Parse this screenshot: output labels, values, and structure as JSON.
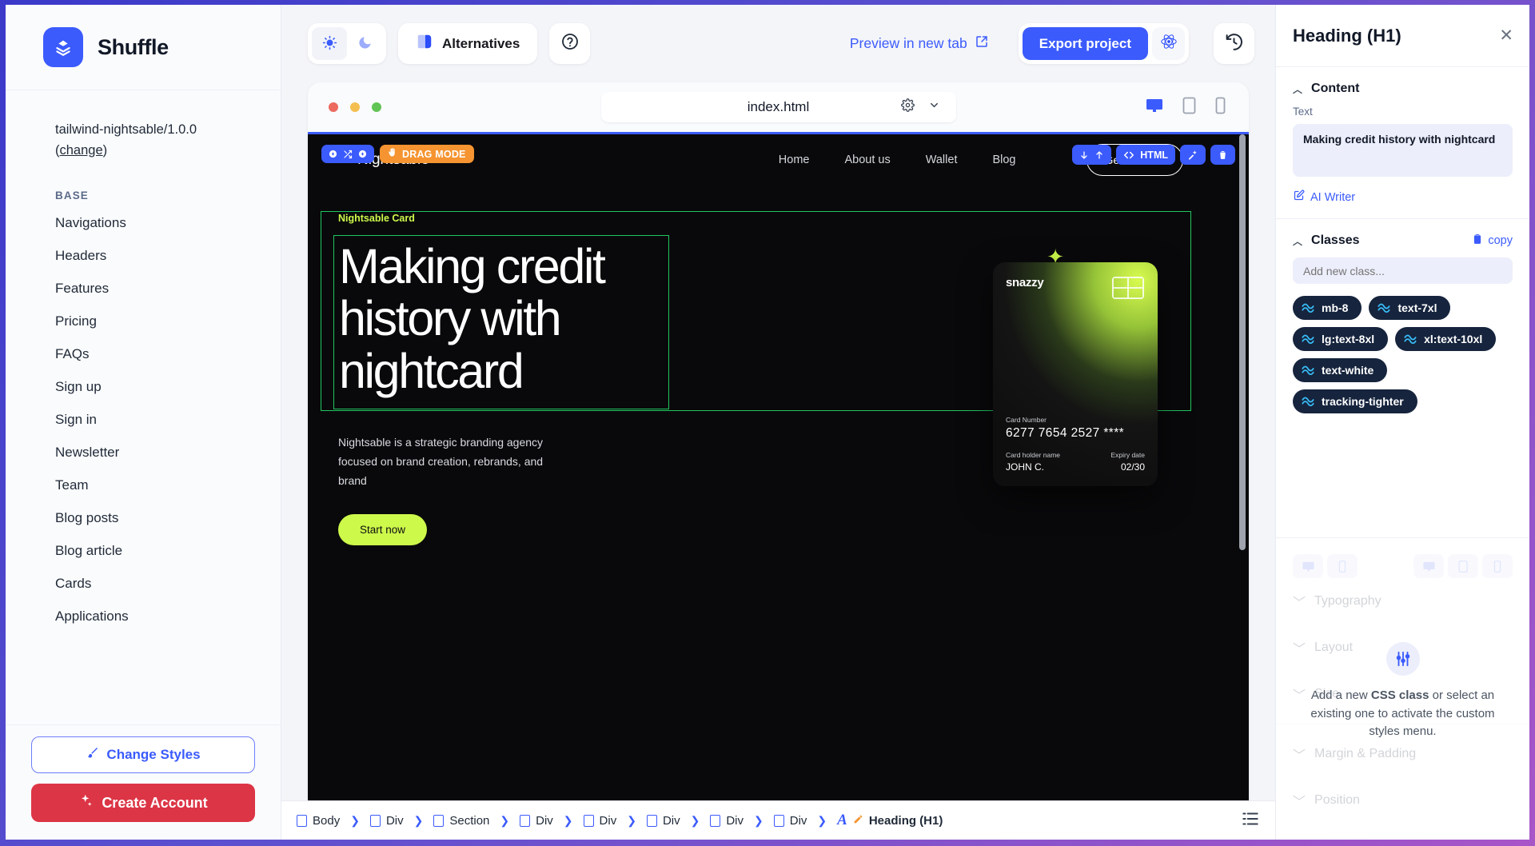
{
  "sidebar": {
    "brand": "Shuffle",
    "project": "tailwind-nightsable/1.0.0",
    "change_label": "change",
    "section_label": "BASE",
    "items": [
      {
        "label": "Navigations"
      },
      {
        "label": "Headers"
      },
      {
        "label": "Features"
      },
      {
        "label": "Pricing"
      },
      {
        "label": "FAQs"
      },
      {
        "label": "Sign up"
      },
      {
        "label": "Sign in"
      },
      {
        "label": "Newsletter"
      },
      {
        "label": "Team"
      },
      {
        "label": "Blog posts"
      },
      {
        "label": "Blog article"
      },
      {
        "label": "Cards"
      },
      {
        "label": "Applications"
      }
    ],
    "change_styles": "Change Styles",
    "create_account": "Create Account"
  },
  "toolbar": {
    "alternatives": "Alternatives",
    "preview": "Preview in new tab",
    "export": "Export project"
  },
  "frame": {
    "url": "index.html"
  },
  "site": {
    "logo": "Nightsable",
    "nav": [
      "Home",
      "About us",
      "Wallet",
      "Blog"
    ],
    "cta": "Get in touch",
    "drag_mode": "DRAG MODE",
    "html_badge": "HTML",
    "eyebrow": "Nightsable Card",
    "heading": "Making credit history with nightcard",
    "subtext": "Nightsable is a strategic branding agency focused on brand creation, rebrands, and brand",
    "start_button": "Start now",
    "card": {
      "brand": "snazzy",
      "number_label": "Card Number",
      "number": "6277 7654 2527 ****",
      "holder_label": "Card holder name",
      "holder": "JOHN C.",
      "expiry_label": "Expiry date",
      "expiry": "02/30"
    }
  },
  "breadcrumb": {
    "items": [
      "Body",
      "Div",
      "Section",
      "Div",
      "Div",
      "Div",
      "Div",
      "Div"
    ],
    "active": "Heading (H1)"
  },
  "panel": {
    "title": "Heading (H1)",
    "content_label": "Content",
    "text_label": "Text",
    "text_value": "Making credit history with nightcard",
    "ai_writer": "AI Writer",
    "classes_label": "Classes",
    "copy_label": "copy",
    "add_class_placeholder": "Add new class...",
    "classes": [
      "mb-8",
      "text-7xl",
      "lg:text-8xl",
      "xl:text-10xl",
      "text-white",
      "tracking-tighter"
    ],
    "ghost_sections": [
      "Typography",
      "Layout",
      "Size",
      "Margin & Padding",
      "Position"
    ],
    "overlay_pre": "Add a new ",
    "overlay_strong": "CSS class",
    "overlay_post": " or select an existing one to activate the custom styles menu."
  },
  "colors": {
    "accent": "#3b5bfd",
    "danger": "#dc3545",
    "lime": "#cdf94b",
    "orange": "#f59431",
    "chip": "#16243d"
  }
}
